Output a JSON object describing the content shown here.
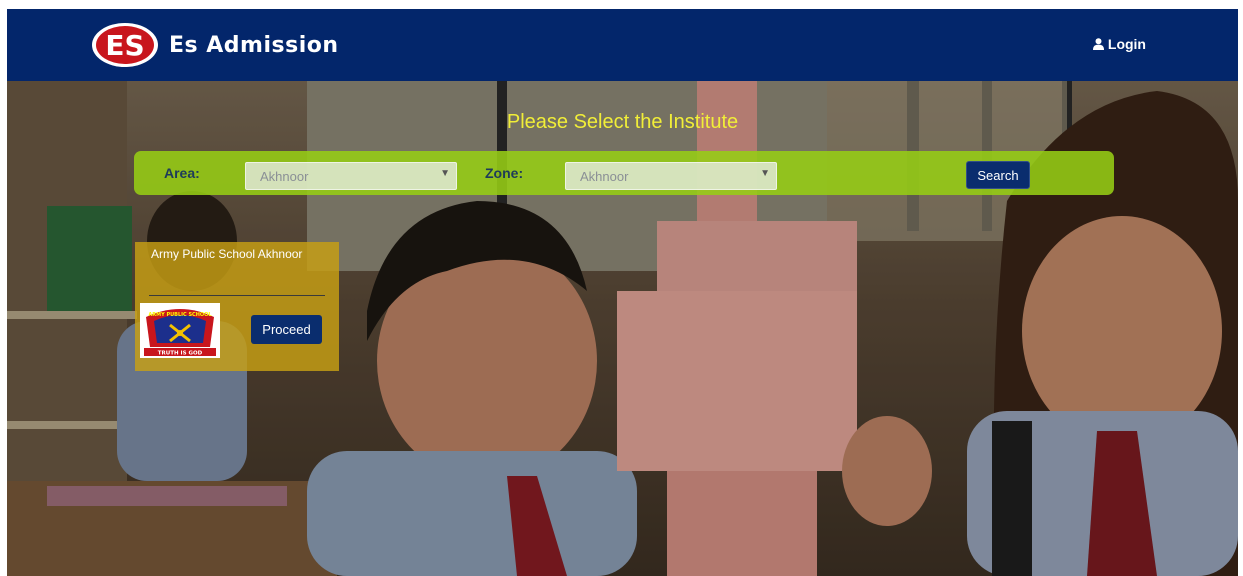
{
  "header": {
    "brand_name": "Es Admission",
    "logo_text": "ES",
    "login_label": "Login",
    "login_icon": "user-icon",
    "background_color": "#03266b"
  },
  "hero": {
    "title": "Please Select the Institute",
    "title_color": "#f1ee38"
  },
  "search": {
    "area_label": "Area:",
    "area_value": "Akhnoor",
    "zone_label": "Zone:",
    "zone_value": "Akhnoor",
    "button_label": "Search",
    "bar_color": "#96cd14"
  },
  "institutes": [
    {
      "name": "Army Public School Akhnoor",
      "logo_top_text": "ARMY PUBLIC SCHOOL",
      "logo_motto": "TRUTH IS GOD",
      "button_label": "Proceed"
    }
  ],
  "colors": {
    "primary": "#0a2d6e",
    "card_bg": "#c8a014"
  }
}
